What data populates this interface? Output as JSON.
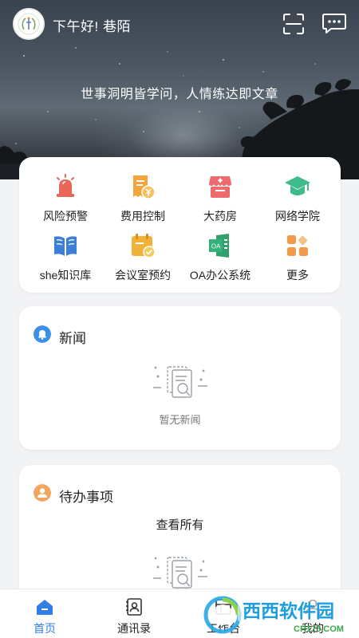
{
  "header": {
    "greeting": "下午好! 巷陌",
    "motto": "世事洞明皆学问，人情练达即文章"
  },
  "grid": [
    {
      "label": "风险预警",
      "icon": "alarm-icon",
      "color": "#e8665a"
    },
    {
      "label": "费用控制",
      "icon": "receipt-yen-icon",
      "color": "#f2a53a"
    },
    {
      "label": "大药房",
      "icon": "pharmacy-icon",
      "color": "#ef6a6a"
    },
    {
      "label": "网络学院",
      "icon": "graduation-cap-icon",
      "color": "#3dbb8a"
    },
    {
      "label": "she知识库",
      "icon": "open-book-icon",
      "color": "#3b7fd6"
    },
    {
      "label": "会议室预约",
      "icon": "calendar-check-icon",
      "color": "#f0b23a"
    },
    {
      "label": "OA办公系统",
      "icon": "oa-icon",
      "color": "#35b07a"
    },
    {
      "label": "更多",
      "icon": "more-grid-icon",
      "color": "#f39a4a"
    }
  ],
  "news": {
    "title": "新闻",
    "empty_text": "暂无新闻",
    "icon_color": "#3b8fe8"
  },
  "todo": {
    "title": "待办事项",
    "view_all": "查看所有",
    "icon_color": "#f2a55f"
  },
  "nav": [
    {
      "label": "首页",
      "icon": "home-icon",
      "active": true
    },
    {
      "label": "通讯录",
      "icon": "contacts-icon",
      "active": false
    },
    {
      "label": "工作台",
      "icon": "workbench-icon",
      "active": false
    },
    {
      "label": "我的",
      "icon": "profile-icon",
      "active": false
    }
  ],
  "watermark": {
    "brand": "西西软件园",
    "site": "CR173.COM"
  },
  "colors": {
    "accent": "#2f7fe6",
    "background": "#f2f3f5"
  }
}
